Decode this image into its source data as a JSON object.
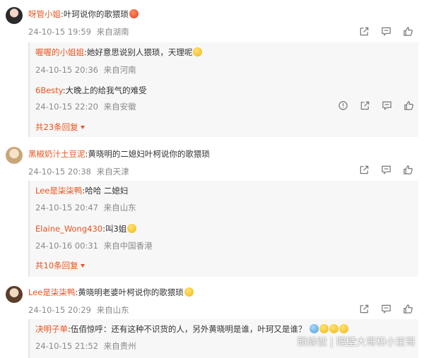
{
  "comments": [
    {
      "username": "呀管小姐",
      "text": "叶珂说你的歌猥琐",
      "emoji": "red-face",
      "time": "24-10-15 19:59",
      "location": "来自湖南",
      "replies": [
        {
          "username": "喔喔的小姐姐",
          "text": "她好意思说别人猥琐，天理呢",
          "emoji": "laughing-tears",
          "time": "24-10-15 20:36",
          "location": "来自河南"
        },
        {
          "username": "6Besty",
          "text": "大晚上的给我气的难受",
          "time": "24-10-15 22:20",
          "location": "来自安徽"
        }
      ],
      "more_replies": "共23条回复"
    },
    {
      "username": "黑椒奶汁土豆泥",
      "text": "黄晓明的二媳妇叶柯说你的歌猥琐",
      "time": "24-10-15 20:38",
      "location": "来自天津",
      "replies": [
        {
          "username": "Lee是柒柒鸭",
          "text": "哈哈 二媳妇",
          "time": "24-10-15 20:47",
          "location": "来自山东"
        },
        {
          "username": "Elaine_Wong430",
          "text": "叫3姐",
          "emoji": "smirk",
          "time": "24-10-16 00:31",
          "location": "来自中国香港"
        }
      ],
      "more_replies": "共10条回复"
    },
    {
      "username": "Lee是柒柒鸭",
      "text": "黄晓明老婆叶柯说你的歌猥琐",
      "emoji": "smile",
      "time": "24-10-15 20:29",
      "location": "来自山东",
      "replies": [
        {
          "username": "决明子单",
          "text": "伍佰惊呼：还有这种不识货的人，另外黄晓明是谁，叶珂又是谁？",
          "time": "24-10-15 21:52",
          "location": "来自贵州"
        }
      ]
    }
  ],
  "watermark": "頭條號 | 隔壁大哥和小宝哥",
  "colors": {
    "username": "#e8531d",
    "meta": "#8a8a8a",
    "reply_bg": "#f7f7f7"
  }
}
